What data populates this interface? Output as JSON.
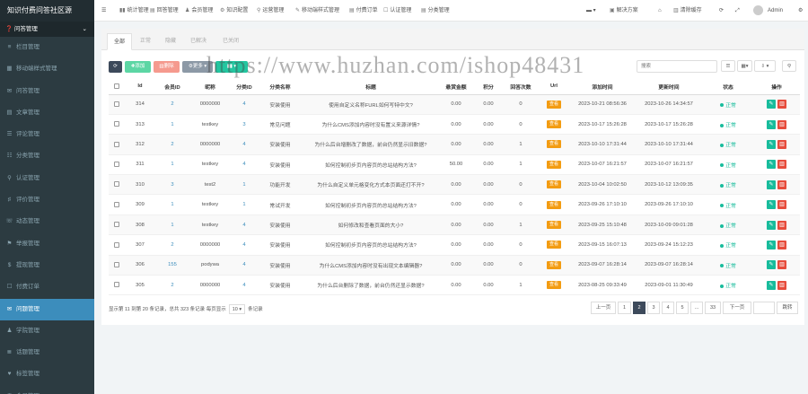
{
  "sidebar": {
    "brand": "知识付费问答社区源",
    "group": "问答管理",
    "items": [
      {
        "icon": "≡",
        "label": "栏目管理"
      },
      {
        "icon": "▦",
        "label": "移动端样式管理"
      },
      {
        "icon": "✉",
        "label": "问答管理"
      },
      {
        "icon": "▤",
        "label": "文章管理"
      },
      {
        "icon": "☰",
        "label": "评论管理"
      },
      {
        "icon": "☷",
        "label": "分类管理"
      },
      {
        "icon": "⚲",
        "label": "认证管理"
      },
      {
        "icon": "♯",
        "label": "评价管理"
      },
      {
        "icon": "☏",
        "label": "动态管理"
      },
      {
        "icon": "⚑",
        "label": "举报管理"
      },
      {
        "icon": "$",
        "label": "提现管理"
      },
      {
        "icon": "☐",
        "label": "付费订单"
      },
      {
        "icon": "✉",
        "label": "问题管理"
      },
      {
        "icon": "♟",
        "label": "学院管理"
      },
      {
        "icon": "≣",
        "label": "话题管理"
      },
      {
        "icon": "♥",
        "label": "标签管理"
      },
      {
        "icon": "♜",
        "label": "会员管理"
      }
    ],
    "active_index": 12
  },
  "topbar": {
    "items": [
      {
        "icon": "▮▮",
        "label": "统计管理"
      },
      {
        "icon": "▤",
        "label": "回答管理"
      },
      {
        "icon": "♟",
        "label": "会员管理"
      },
      {
        "icon": "⚙",
        "label": "知识配置"
      },
      {
        "icon": "⚲",
        "label": "运营管理"
      },
      {
        "icon": "✎",
        "label": "移动端样式管理"
      },
      {
        "icon": "▤",
        "label": "付费订单"
      },
      {
        "icon": "☐",
        "label": "认证管理"
      },
      {
        "icon": "▤",
        "label": "分类管理"
      }
    ],
    "right": {
      "solution": "解决方案",
      "clear_cache": "清除缓存",
      "user": "Admin"
    }
  },
  "tabs": [
    "全部",
    "正常",
    "隐藏",
    "已解决",
    "已关闭"
  ],
  "toolbar": {
    "add": "添加",
    "delete": "删除",
    "more": "更多",
    "search_placeholder": "搜索"
  },
  "table": {
    "headers": [
      "",
      "Id",
      "会员ID",
      "昵称",
      "分类ID",
      "分类名称",
      "标题",
      "悬赏金额",
      "积分",
      "回答次数",
      "Url",
      "添加时间",
      "更新时间",
      "状态",
      "操作"
    ],
    "rows": [
      [
        "314",
        "2",
        "0000000",
        "4",
        "安装使用",
        "使用自定义名称FURL如何写特中文?",
        "0.00",
        "0.00",
        "0",
        "查看",
        "2023-10-21 08:56:36",
        "2023-10-26 14:34:57",
        "正常"
      ],
      [
        "313",
        "1",
        "testkey",
        "3",
        "常见问题",
        "为什么CMS添加内容时没有置义来源详情?",
        "0.00",
        "0.00",
        "0",
        "查看",
        "2023-10-17 15:26:28",
        "2023-10-17 15:26:28",
        "正常"
      ],
      [
        "312",
        "2",
        "0000000",
        "4",
        "安装使用",
        "为什么后台增删改了数据，前台仍然显示旧数据?",
        "0.00",
        "0.00",
        "1",
        "查看",
        "2023-10-10 17:31:44",
        "2023-10-10 17:31:44",
        "正常"
      ],
      [
        "311",
        "1",
        "testkey",
        "4",
        "安装使用",
        "如何控制初步页内容页的总站结构方法?",
        "50.00",
        "0.00",
        "1",
        "查看",
        "2023-10-07 16:21:57",
        "2023-10-07 16:21:57",
        "正常"
      ],
      [
        "310",
        "3",
        "test2",
        "1",
        "功能开发",
        "为什么自定义单元格变化方式本页面还打不开?",
        "0.00",
        "0.00",
        "0",
        "查看",
        "2023-10-04 10:02:50",
        "2023-10-12 13:09:35",
        "正常"
      ],
      [
        "309",
        "1",
        "testkey",
        "1",
        "常试开发",
        "如何控制初步页内容页的总站结构方法?",
        "0.00",
        "0.00",
        "0",
        "查看",
        "2023-09-26 17:10:10",
        "2023-09-26 17:10:10",
        "正常"
      ],
      [
        "308",
        "1",
        "testkey",
        "4",
        "安装使用",
        "如何修改和查看页面的大小?",
        "0.00",
        "0.00",
        "1",
        "查看",
        "2023-09-25 15:10:48",
        "2023-10-09 09:01:28",
        "正常"
      ],
      [
        "307",
        "2",
        "0000000",
        "4",
        "安装使用",
        "如何控制初步页内容页的总站结构方法?",
        "0.00",
        "0.00",
        "0",
        "查看",
        "2023-09-15 16:07:13",
        "2023-09-24 15:12:23",
        "正常"
      ],
      [
        "306",
        "155",
        "podywa",
        "4",
        "安装使用",
        "为什么CMS添加内容时没有出现文本编辑器?",
        "0.00",
        "0.00",
        "0",
        "查看",
        "2023-09-07 16:28:14",
        "2023-09-07 16:28:14",
        "正常"
      ],
      [
        "305",
        "2",
        "0000000",
        "4",
        "安装使用",
        "为什么后台删除了数据，前台仍然还显示数据?",
        "0.00",
        "0.00",
        "1",
        "查看",
        "2023-08-25 09:33:49",
        "2023-09-01 11:30:49",
        "正常"
      ]
    ]
  },
  "footer": {
    "info_prefix": "显示第 11 到第 20 条记录，总共 323 条记录 每页显示",
    "page_size": "10 ▾",
    "info_suffix": "条记录"
  },
  "pagination": [
    "上一页",
    "1",
    "2",
    "3",
    "4",
    "5",
    "...",
    "33",
    "下一页",
    "",
    "跳转"
  ],
  "pagination_active": 2,
  "watermark": "https://www.huzhan.com/ishop48431"
}
